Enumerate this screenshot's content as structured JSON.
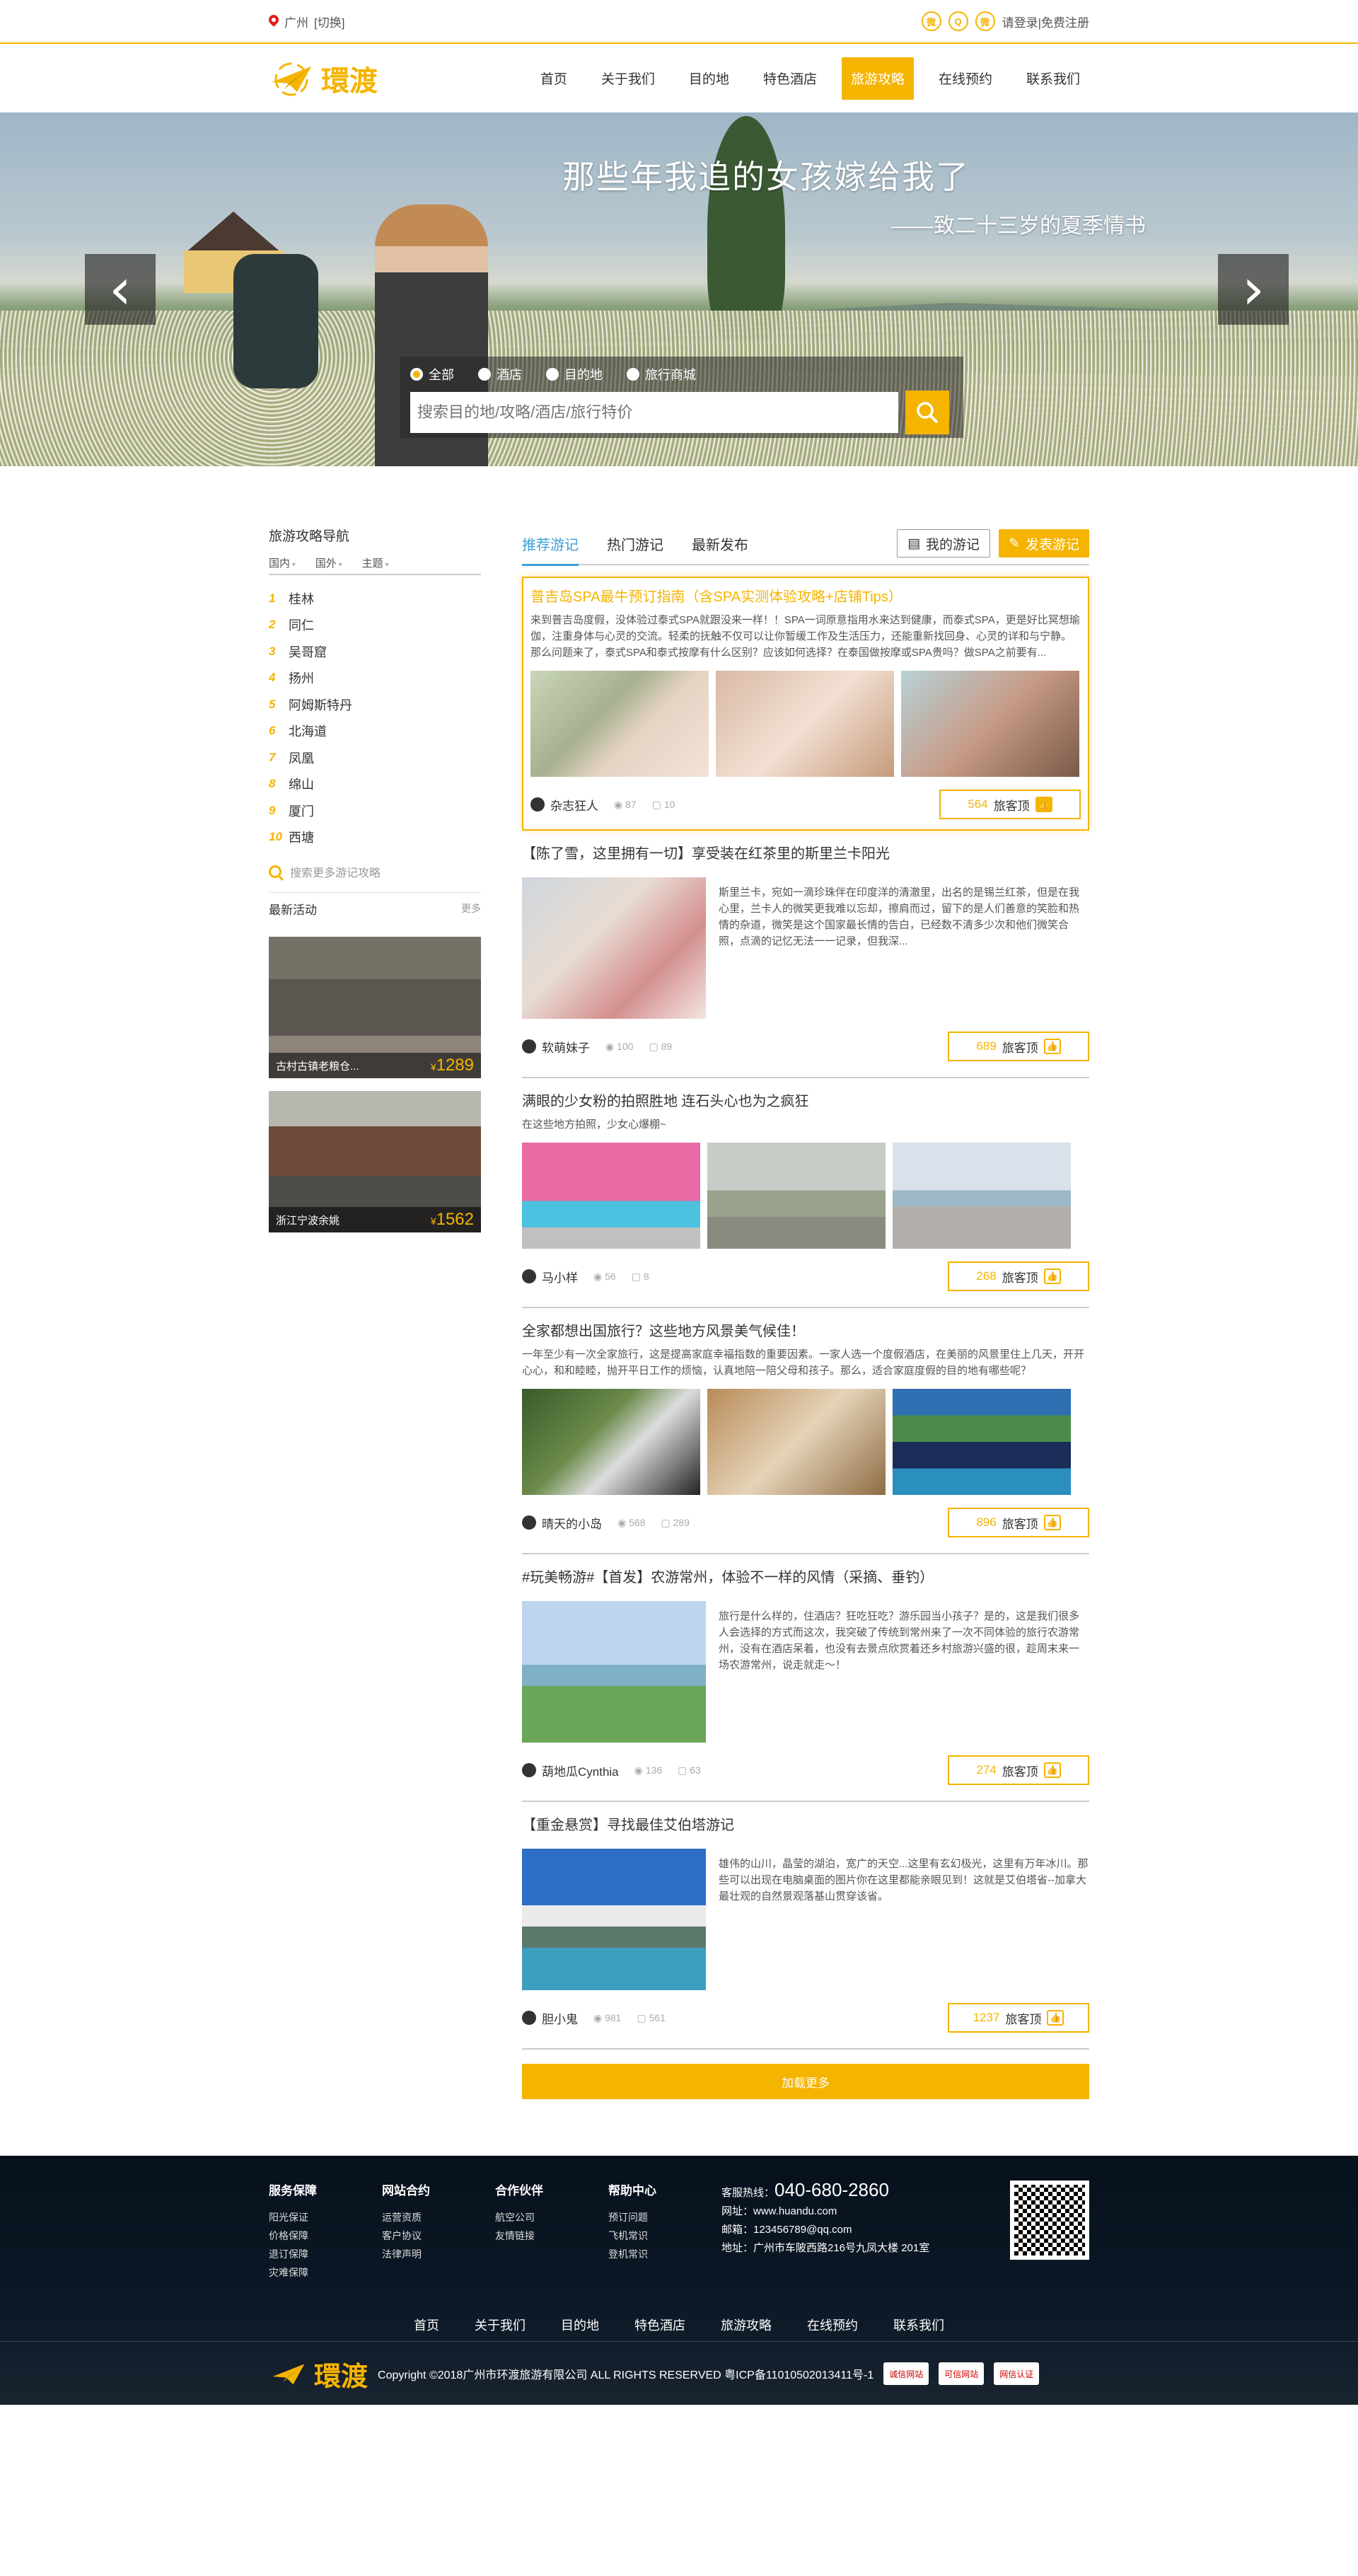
{
  "topbar": {
    "location": "广州",
    "switch": "[切换]",
    "social": [
      "微",
      "Q",
      "微"
    ],
    "login": "请登录",
    "sep": "|",
    "register": "免费注册"
  },
  "header": {
    "logo_text": "環渡",
    "nav": [
      "首页",
      "关于我们",
      "目的地",
      "特色酒店",
      "旅游攻略",
      "在线预约",
      "联系我们"
    ],
    "active_nav": "旅游攻略"
  },
  "banner": {
    "title": "那些年我追的女孩嫁给我了",
    "subtitle": "——致二十三岁的夏季情书",
    "prev": "‹",
    "next": "›",
    "search": {
      "options": [
        "全部",
        "酒店",
        "目的地",
        "旅行商城"
      ],
      "selected": "全部",
      "placeholder": "搜索目的地/攻略/酒店/旅行特价"
    }
  },
  "sidebar": {
    "nav_title": "旅游攻略导航",
    "filters": [
      "国内",
      "国外",
      "主题"
    ],
    "destinations": [
      {
        "rank": "1",
        "name": "桂林"
      },
      {
        "rank": "2",
        "name": "同仁"
      },
      {
        "rank": "3",
        "name": "吴哥窟"
      },
      {
        "rank": "4",
        "name": "扬州"
      },
      {
        "rank": "5",
        "name": "阿姆斯特丹"
      },
      {
        "rank": "6",
        "name": "北海道"
      },
      {
        "rank": "7",
        "name": "凤凰"
      },
      {
        "rank": "8",
        "name": "绵山"
      },
      {
        "rank": "9",
        "name": "厦门"
      },
      {
        "rank": "10",
        "name": "西塘"
      }
    ],
    "search_more": "搜索更多游记攻略",
    "activities_title": "最新活动",
    "activities_more": "更多",
    "activities": [
      {
        "label": "古村古镇老粮仓...",
        "currency": "¥",
        "price": "1289"
      },
      {
        "label": "浙江宁波余姚",
        "currency": "¥",
        "price": "1562"
      }
    ]
  },
  "tabs": {
    "items": [
      "推荐游记",
      "热门游记",
      "最新发布"
    ],
    "active": "推荐游记",
    "my_notes": "我的游记",
    "publish": "发表游记"
  },
  "posts": [
    {
      "title": "普吉岛SPA最牛预订指南（含SPA实测体验攻略+店铺Tips）",
      "excerpt": "来到普吉岛度假，没体验过泰式SPA就跟没来一样！！SPA一词原意指用水来达到健康，而泰式SPA，更是好比冥想瑜伽，注重身体与心灵的交流。轻柔的抚触不仅可以让你暂缓工作及生活压力，还能重新找回身、心灵的详和与宁静。那么问题来了，泰式SPA和泰式按摩有什么区别？应该如何选择？在泰国做按摩或SPA贵吗？做SPA之前要有...",
      "author": "杂志狂人",
      "views": "87",
      "comments": "10",
      "likes": "564",
      "like_label": "旅客顶"
    },
    {
      "title": "【陈了雪，这里拥有一切】享受装在红茶里的斯里兰卡阳光",
      "excerpt": "斯里兰卡，宛如一滴珍珠伴在印度洋的清澈里，出名的是锡兰红茶，但是在我心里，兰卡人的微笑更我难以忘却，擦肩而过，留下的是人们善意的笑脸和热情的杂道，微笑是这个国家最长情的告白，已经数不清多少次和他们微笑合照，点滴的记忆无法一一记录，但我深...",
      "author": "软萌妹子",
      "views": "100",
      "comments": "89",
      "likes": "689",
      "like_label": "旅客顶"
    },
    {
      "title": "满眼的少女粉的拍照胜地 连石头心也为之疯狂",
      "excerpt": "在这些地方拍照，少女心爆棚~",
      "author": "马小样",
      "views": "56",
      "comments": "8",
      "likes": "268",
      "like_label": "旅客顶"
    },
    {
      "title": "全家都想出国旅行？这些地方风景美气候佳！",
      "excerpt": "一年至少有一次全家旅行，这是提高家庭幸福指数的重要因素。一家人选一个度假酒店，在美丽的风景里住上几天，开开心心，和和睦睦，抛开平日工作的烦恼，认真地陪一陪父母和孩子。那么，适合家庭度假的目的地有哪些呢？",
      "author": "晴天的小岛",
      "views": "568",
      "comments": "289",
      "likes": "896",
      "like_label": "旅客顶"
    },
    {
      "title": "#玩美畅游#【首发】农游常州，体验不一样的风情（采摘、垂钓）",
      "excerpt": "旅行是什么样的，住酒店？狂吃狂吃？游乐园当小孩子？是的，这是我们很多人会选择的方式而这次，我突破了传统到常州来了一次不同体验的旅行农游常州，没有在酒店呆着，也没有去景点欣赏着还乡村旅游兴盛的很，趁周末来一场农游常州，说走就走～！",
      "author": "葫地瓜Cynthia",
      "views": "136",
      "comments": "63",
      "likes": "274",
      "like_label": "旅客顶"
    },
    {
      "title": "【重金悬赏】寻找最佳艾伯塔游记",
      "excerpt": "雄伟的山川，晶莹的湖泊，宽广的天空...这里有玄幻极光，这里有万年冰川。那些可以出现在电脑桌面的图片你在这里都能亲眼见到！这就是艾伯塔省--加拿大最壮观的自然景观落基山贯穿该省。",
      "author": "胆小鬼",
      "views": "981",
      "comments": "561",
      "likes": "1237",
      "like_label": "旅客顶"
    }
  ],
  "load_more": "加载更多",
  "footer": {
    "columns": [
      {
        "title": "服务保障",
        "items": [
          "阳光保证",
          "价格保障",
          "退订保障",
          "灾难保障"
        ]
      },
      {
        "title": "网站合约",
        "items": [
          "运营资质",
          "客户协议",
          "法律声明"
        ]
      },
      {
        "title": "合作伙伴",
        "items": [
          "航空公司",
          "友情链接"
        ]
      },
      {
        "title": "帮助中心",
        "items": [
          "预订问题",
          "飞机常识",
          "登机常识"
        ]
      }
    ],
    "hotline_label": "客服热线：",
    "hotline": "040-680-2860",
    "website": "网址：www.huandu.com",
    "email": "邮箱：123456789@qq.com",
    "address": "地址：广州市车陂西路216号九凤大楼 201室",
    "nav": [
      "首页",
      "关于我们",
      "目的地",
      "特色酒店",
      "旅游攻略",
      "在线预约",
      "联系我们"
    ],
    "logo_text": "環渡",
    "copyright": "Copyright ©2018广州市环渡旅游有限公司 ALL RIGHTS RESERVED 粤ICP备11010502013411号-1",
    "badges": [
      "诚信网站",
      "可信网站",
      "网信认证"
    ]
  },
  "colors": {
    "accent": "#f5b400",
    "tab_active": "#3aa0d8",
    "footer_bg": "#07111d"
  }
}
